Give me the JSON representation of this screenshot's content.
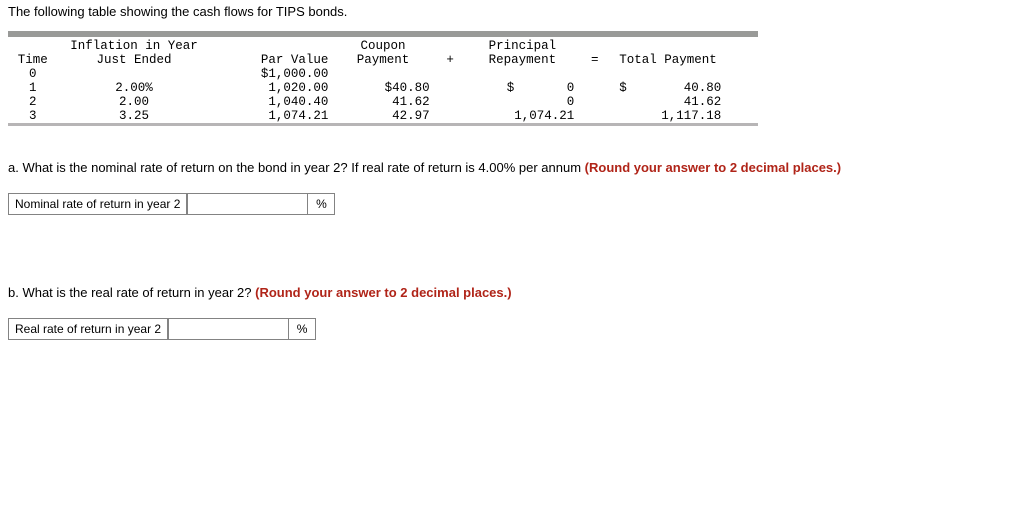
{
  "intro": "The following table showing the cash flows for TIPS bonds.",
  "table": {
    "headers": {
      "time": "Time",
      "inflation_line1": "Inflation in Year",
      "inflation_line2": "Just Ended",
      "par": "Par Value",
      "coupon_line1": "Coupon",
      "coupon_line2": "Payment",
      "plus": "+",
      "principal_line1": "Principal",
      "principal_line2": "Repayment",
      "eq": "=",
      "total": "Total Payment"
    },
    "rows": [
      {
        "time": "0",
        "inflation": "",
        "par": "$1,000.00",
        "coupon": "",
        "plus": "",
        "principal": "",
        "eq": "",
        "total_dol": "",
        "total_val": ""
      },
      {
        "time": "1",
        "inflation": "2.00%",
        "par": "1,020.00",
        "coupon": "$40.80",
        "plus": "",
        "principal": "$       0",
        "eq": "",
        "total_dol": "$",
        "total_val": "40.80"
      },
      {
        "time": "2",
        "inflation": "2.00",
        "par": "1,040.40",
        "coupon": "41.62",
        "plus": "",
        "principal": "0",
        "eq": "",
        "total_dol": "",
        "total_val": "41.62"
      },
      {
        "time": "3",
        "inflation": "3.25",
        "par": "1,074.21",
        "coupon": "42.97",
        "plus": "",
        "principal": "1,074.21",
        "eq": "",
        "total_dol": "",
        "total_val": "1,117.18"
      }
    ]
  },
  "qa": {
    "text_prefix": "a. What is the nominal rate of return on the bond in year 2? If real rate of return is 4.00% per annum ",
    "text_bold": "(Round your answer to 2 decimal places.)",
    "label": "Nominal rate of return in year 2",
    "pct": "%"
  },
  "qb": {
    "text_prefix": "b. What is the real rate of return in year 2? ",
    "text_bold": "(Round your answer to 2 decimal places.)",
    "label": "Real rate of return in year 2",
    "pct": "%"
  },
  "chart_data": {
    "type": "table",
    "title": "Cash flows for TIPS bonds",
    "columns": [
      "Time",
      "Inflation in Year Just Ended",
      "Par Value",
      "Coupon Payment",
      "Principal Repayment",
      "Total Payment"
    ],
    "rows": [
      [
        0,
        null,
        1000.0,
        null,
        null,
        null
      ],
      [
        1,
        2.0,
        1020.0,
        40.8,
        0,
        40.8
      ],
      [
        2,
        2.0,
        1040.4,
        41.62,
        0,
        41.62
      ],
      [
        3,
        3.25,
        1074.21,
        42.97,
        1074.21,
        1117.18
      ]
    ]
  }
}
